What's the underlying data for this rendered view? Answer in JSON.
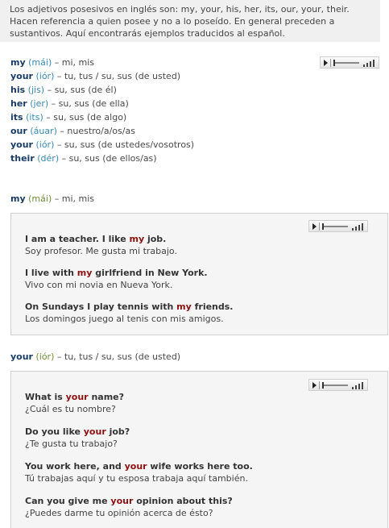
{
  "intro": {
    "line1": "Los adjetivos posesivos en inglés son: my, your, his, her, its, our, your, their.",
    "line2": "Hacen referencia a quien posee y no a lo poseído. En general preceden a",
    "line3": "sustantivos. Aquí encontrarás ejemplos traducidos al español."
  },
  "adjectives": [
    {
      "word": "my",
      "pron": "(mái)",
      "meaning": "– mi, mis"
    },
    {
      "word": "your",
      "pron": "(iór)",
      "meaning": "– tu, tus / su, sus (de usted)"
    },
    {
      "word": "his",
      "pron": "(jis)",
      "meaning": "– su, sus (de él)"
    },
    {
      "word": "her",
      "pron": "(jer)",
      "meaning": "– su, sus (de ella)"
    },
    {
      "word": "its",
      "pron": "(its)",
      "meaning": "– su, sus (de algo)"
    },
    {
      "word": "our",
      "pron": "(áuar)",
      "meaning": "– nuestro/a/os/as"
    },
    {
      "word": "your",
      "pron": "(iór)",
      "meaning": "– su, sus (de ustedes/vosotros)"
    },
    {
      "word": "their",
      "pron": "(dér)",
      "meaning": "– su, sus (de ellos/as)"
    }
  ],
  "sections": [
    {
      "word": "my",
      "pron": "(mái)",
      "meaning": "– mi, mis",
      "examples": [
        {
          "en_before": "I am a teacher. I like ",
          "en_hl": "my",
          "en_after": " job.",
          "es": "Soy profesor. Me gusta mi trabajo."
        },
        {
          "en_before": "I live with ",
          "en_hl": "my",
          "en_after": " girlfriend in New York.",
          "es": "Vivo con mi novia en Nueva York."
        },
        {
          "en_before": "On Sundays I play tennis with ",
          "en_hl": "my",
          "en_after": " friends.",
          "es": "Los domingos juego al tenis con mis amigos."
        }
      ]
    },
    {
      "word": "your",
      "pron": "(iór)",
      "meaning": "– tu, tus / su, sus (de usted)",
      "examples": [
        {
          "en_before": "What is ",
          "en_hl": "your",
          "en_after": " name?",
          "es": "¿Cuál es tu nombre?"
        },
        {
          "en_before": "Do you like ",
          "en_hl": "your",
          "en_after": " job?",
          "es": "¿Te gusta tu trabajo?"
        },
        {
          "en_before": "You work here, and ",
          "en_hl": "your",
          "en_after": " wife works here too.",
          "es": "Tú trabajas aquí y tu esposa trabaja aquí también."
        },
        {
          "en_before": "Can you give me ",
          "en_hl": "your",
          "en_after": " opinion about this?",
          "es": "¿Puedes darme tu opinión acerca de ésto?"
        }
      ]
    }
  ],
  "colors": {
    "word": "#1a3b66",
    "pron": "#3a8ab4",
    "pron_heading": "#6e8f3a",
    "highlight": "#8c1111",
    "box_bg": "#f5f5f5"
  },
  "icons": {
    "play": "play-icon",
    "volume": "volume-icon"
  }
}
